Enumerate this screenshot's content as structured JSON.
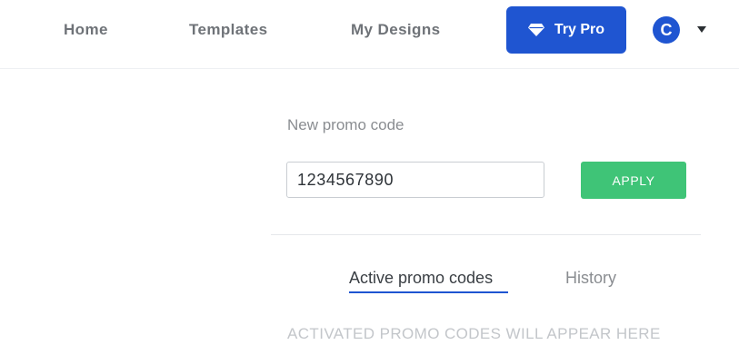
{
  "nav": {
    "home": "Home",
    "templates": "Templates",
    "my_designs": "My Designs",
    "try_pro": "Try Pro",
    "avatar_letter": "C"
  },
  "promo": {
    "label": "New promo code",
    "input_value": "1234567890",
    "apply_label": "APPLY"
  },
  "tabs": {
    "active_label": "Active promo codes",
    "history_label": "History"
  },
  "empty_message": "ACTIVATED PROMO CODES WILL APPEAR HERE",
  "colors": {
    "brand_blue": "#1f55d1",
    "apply_green": "#3fc477"
  }
}
